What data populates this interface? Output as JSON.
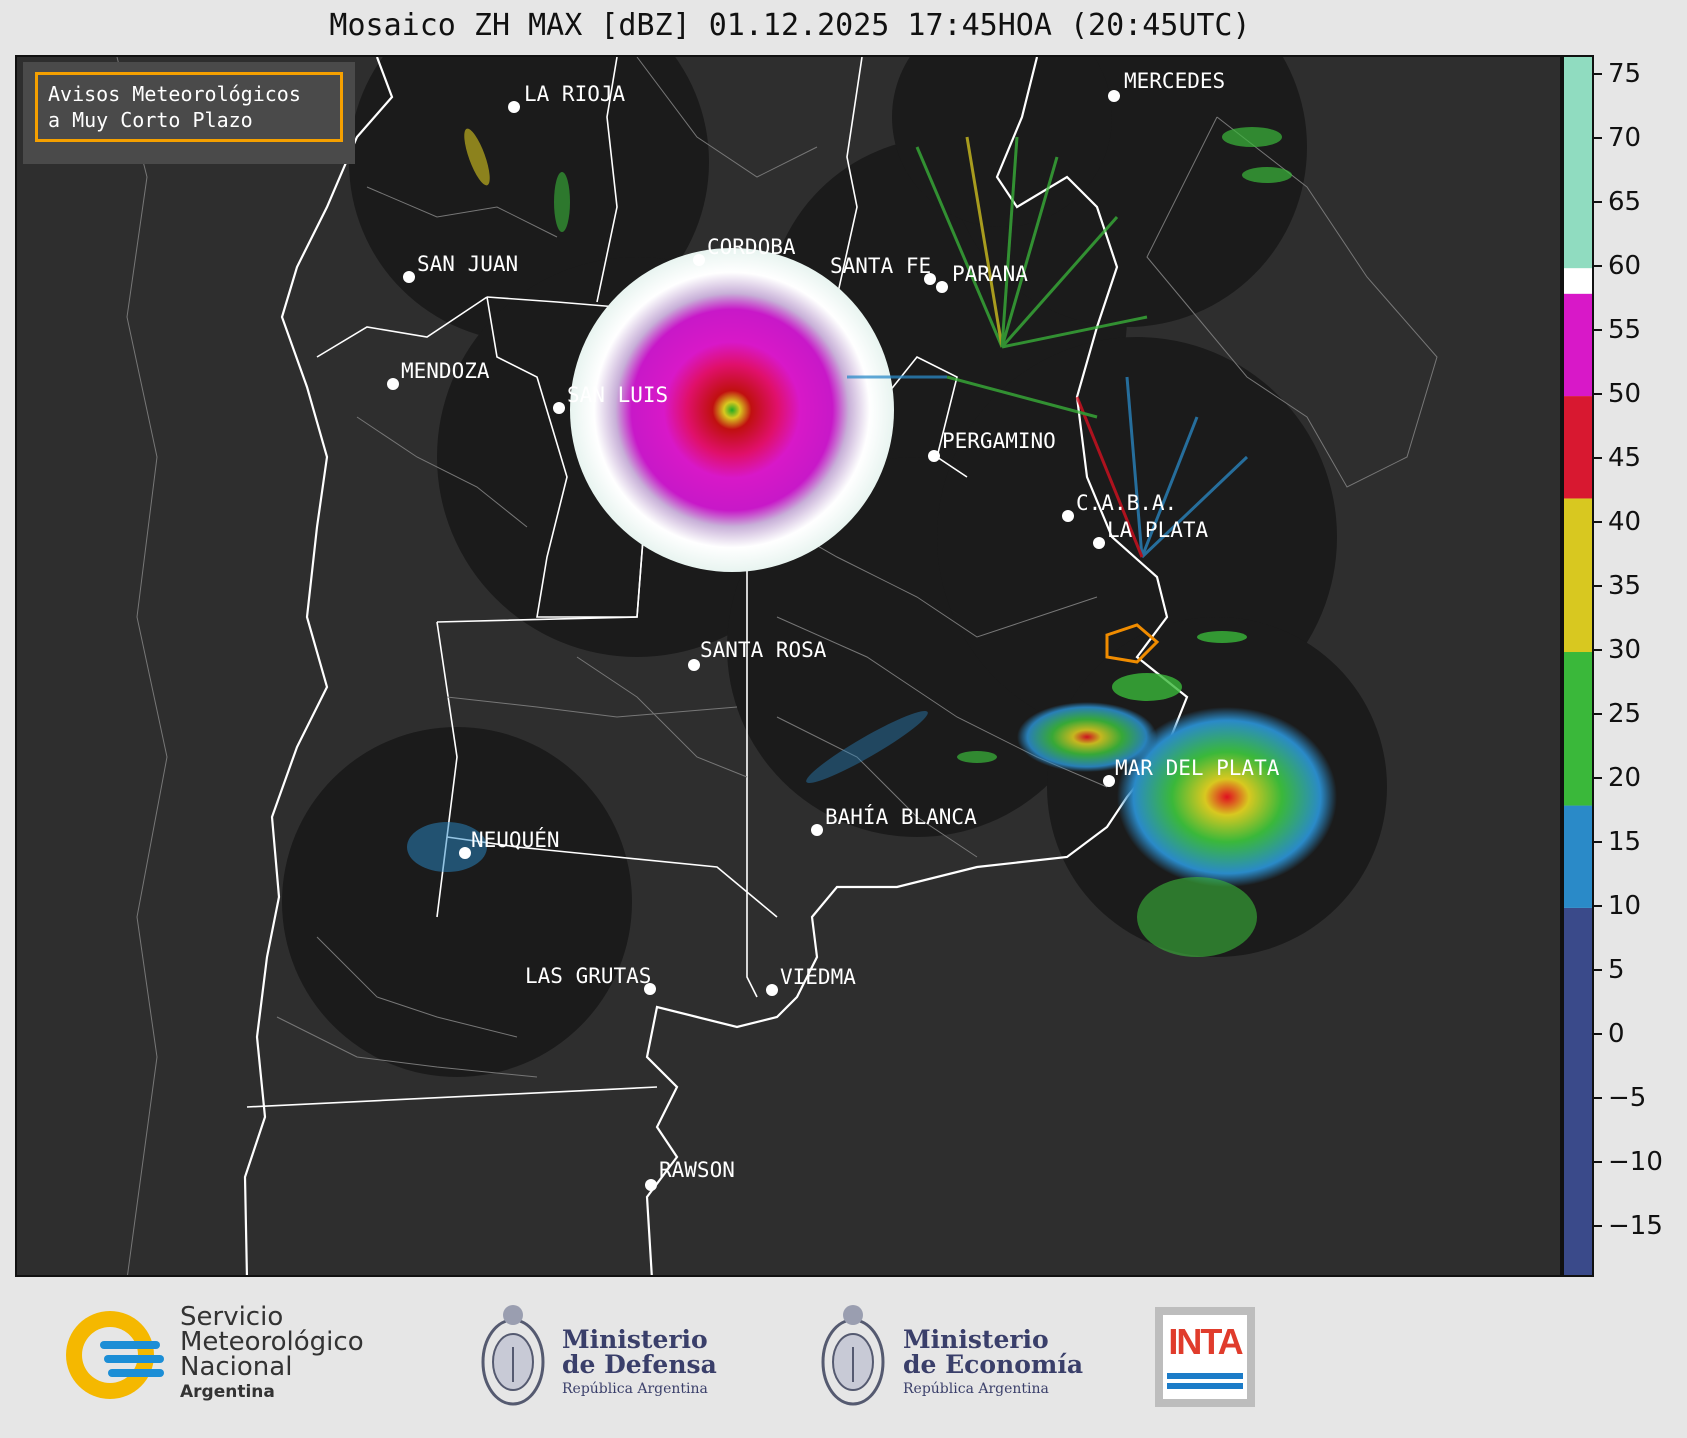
{
  "title": "Mosaico ZH MAX [dBZ] 01.12.2025 17:45HOA (20:45UTC)",
  "avisos": {
    "line1": "Avisos Meteorológicos",
    "line2": "a Muy Corto Plazo"
  },
  "cities": [
    {
      "name": "LA RIOJA"
    },
    {
      "name": "CORDOBA"
    },
    {
      "name": "SAN JUAN"
    },
    {
      "name": "SANTA FE"
    },
    {
      "name": "PARANA"
    },
    {
      "name": "MERCEDES"
    },
    {
      "name": "MENDOZA"
    },
    {
      "name": "SAN LUIS"
    },
    {
      "name": "PERGAMINO"
    },
    {
      "name": "C.A.B.A."
    },
    {
      "name": "LA PLATA"
    },
    {
      "name": "SANTA ROSA"
    },
    {
      "name": "MAR DEL PLATA"
    },
    {
      "name": "BAHÍA BLANCA"
    },
    {
      "name": "NEUQUÉN"
    },
    {
      "name": "LAS GRUTAS"
    },
    {
      "name": "VIEDMA"
    },
    {
      "name": "RAWSON"
    }
  ],
  "colorbar": {
    "unit": "dBZ",
    "min": -19,
    "max": 76.5,
    "ticks": [
      75,
      70,
      65,
      60,
      55,
      50,
      45,
      40,
      35,
      30,
      25,
      20,
      15,
      10,
      5,
      0,
      -5,
      -10,
      -15
    ],
    "tick_labels": [
      "75",
      "70",
      "65",
      "60",
      "55",
      "50",
      "45",
      "40",
      "35",
      "30",
      "25",
      "20",
      "15",
      "10",
      "5",
      "0",
      "−5",
      "−10",
      "−15"
    ],
    "bands": [
      {
        "from": -19,
        "to": 10,
        "color": "#3a4a8a"
      },
      {
        "from": 10,
        "to": 18,
        "color": "#2a8ac8"
      },
      {
        "from": 18,
        "to": 30,
        "color": "#3ab83a"
      },
      {
        "from": 30,
        "to": 42,
        "color": "#d8c820"
      },
      {
        "from": 42,
        "to": 50,
        "color": "#d81830"
      },
      {
        "from": 50,
        "to": 58,
        "color": "#d818c8"
      },
      {
        "from": 58,
        "to": 60,
        "color": "#ffffff"
      },
      {
        "from": 60,
        "to": 76.5,
        "color": "#90dcc0"
      }
    ]
  },
  "logos": {
    "smn": {
      "line1": "Servicio",
      "line2": "Meteorológico",
      "line3": "Nacional",
      "line4": "Argentina"
    },
    "defensa": {
      "line1": "Ministerio",
      "line2": "de Defensa",
      "line3": "República Argentina"
    },
    "economia": {
      "line1": "Ministerio",
      "line2": "de Economía",
      "line3": "República Argentina"
    },
    "inta": {
      "word": "INTA"
    }
  },
  "colors": {
    "map_bg": "#2e2e2e",
    "radar_bg": "#1b1b1b",
    "border": "#ffffff",
    "accent": "#f5a000"
  }
}
